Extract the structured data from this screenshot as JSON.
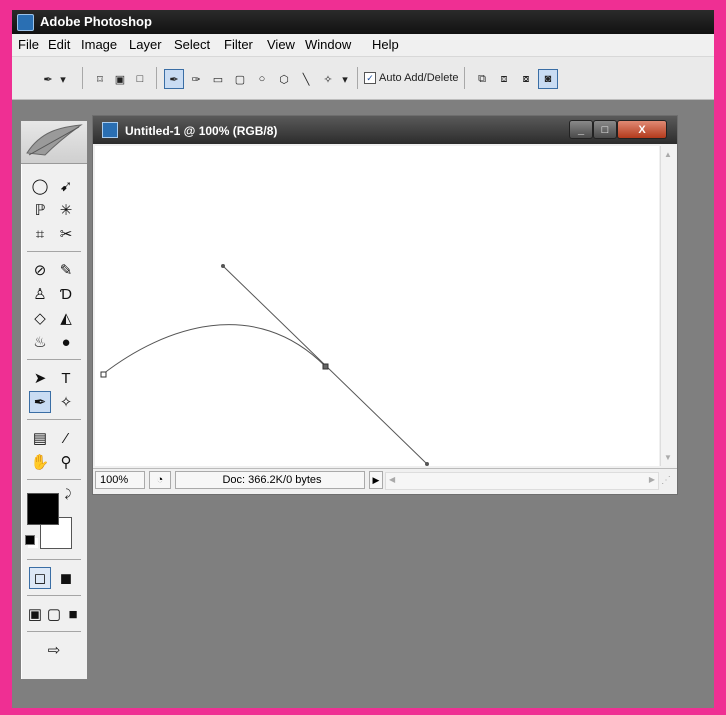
{
  "app": {
    "title": "Adobe Photoshop"
  },
  "menu": [
    "File",
    "Edit",
    "Image",
    "Layer",
    "Select",
    "Filter",
    "View",
    "Window",
    "Help"
  ],
  "options_bar": {
    "auto_add_delete_label": "Auto Add/Delete",
    "auto_add_delete_checked": true
  },
  "document": {
    "title": "Untitled-1 @ 100% (RGB/8)",
    "zoom": "100%",
    "doc_info": "Doc: 366.2K/0 bytes",
    "window_buttons": {
      "minimize": "_",
      "maximize": "□",
      "close": "X"
    }
  },
  "colors": {
    "border_accent": "#ef2f93",
    "workspace": "#7f7f7f",
    "selected_tool": "#c9dcf3",
    "foreground": "#000000",
    "background": "#ffffff"
  }
}
